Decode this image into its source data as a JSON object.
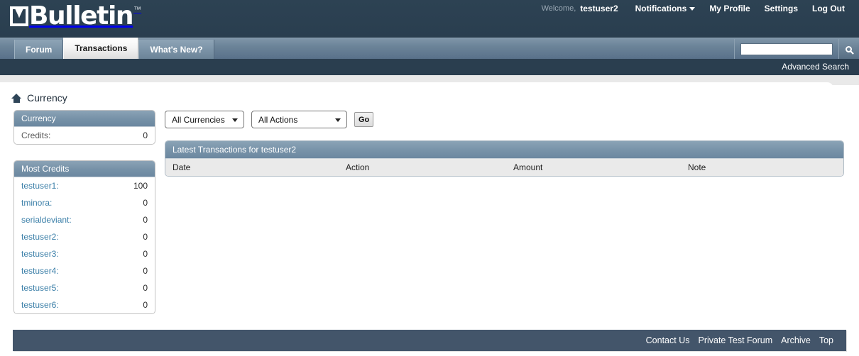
{
  "header": {
    "logo_text": "Bulletin",
    "logo_tm": "™",
    "welcome_label": "Welcome,",
    "username": "testuser2",
    "nav": [
      {
        "label": "Notifications",
        "has_caret": true
      },
      {
        "label": "My Profile",
        "has_caret": false
      },
      {
        "label": "Settings",
        "has_caret": false
      },
      {
        "label": "Log Out",
        "has_caret": false
      }
    ]
  },
  "navbar": {
    "tabs": [
      {
        "label": "Forum",
        "active": false
      },
      {
        "label": "Transactions",
        "active": true
      },
      {
        "label": "What's New?",
        "active": false
      }
    ],
    "search": {
      "value": "",
      "placeholder": "",
      "icon": "search-icon"
    },
    "advanced_search_label": "Advanced Search"
  },
  "breadcrumb": {
    "home_icon": "home-icon",
    "title": "Currency"
  },
  "sidebar": {
    "currency_block": {
      "title": "Currency",
      "rows": [
        {
          "label": "Credits:",
          "value": "0"
        }
      ]
    },
    "most_credits_block": {
      "title": "Most Credits",
      "rows": [
        {
          "label": "testuser1:",
          "value": "100"
        },
        {
          "label": "tminora:",
          "value": "0"
        },
        {
          "label": "serialdeviant:",
          "value": "0"
        },
        {
          "label": "testuser2:",
          "value": "0"
        },
        {
          "label": "testuser3:",
          "value": "0"
        },
        {
          "label": "testuser4:",
          "value": "0"
        },
        {
          "label": "testuser5:",
          "value": "0"
        },
        {
          "label": "testuser6:",
          "value": "0"
        }
      ]
    }
  },
  "filters": {
    "currency_select": {
      "selected": "All Currencies"
    },
    "action_select": {
      "selected": "All Actions"
    },
    "go_label": "Go"
  },
  "transactions": {
    "panel_title": "Latest Transactions for testuser2",
    "columns": [
      "Date",
      "Action",
      "Amount",
      "Note"
    ],
    "rows": []
  },
  "footer": {
    "links": [
      "Contact Us",
      "Private Test Forum",
      "Archive",
      "Top"
    ]
  },
  "colors": {
    "header_bg": "#2b4051",
    "navbar_bg": "#6b8398",
    "panel_header": "#7792a8",
    "footer_bg": "#43556a",
    "link": "#3b7fa8"
  }
}
